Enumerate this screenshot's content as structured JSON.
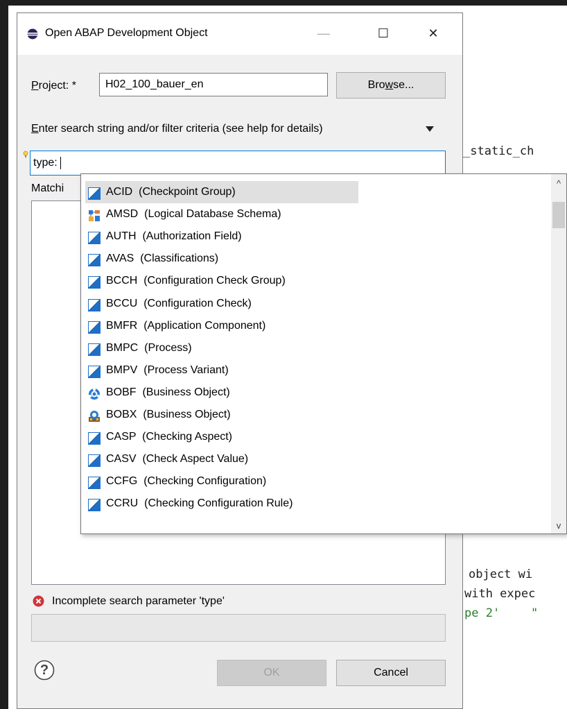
{
  "dialog": {
    "title": "Open ABAP Development Object",
    "minimize": "—",
    "maximize": "☐",
    "close": "✕",
    "project_label_mnemonic": "P",
    "project_label_rest": "roject: *",
    "project_value": "H02_100_bauer_en",
    "browse_pre": "Bro",
    "browse_mnemonic": "w",
    "browse_post": "se...",
    "search_label_mnemonic": "E",
    "search_label_rest": "nter search string and/or filter criteria (see help for details)",
    "search_value": "type: ",
    "matching_label": "Matchi",
    "error_text": "Incomplete search parameter 'type'",
    "help": "?",
    "ok": "OK",
    "cancel": "Cancel"
  },
  "editor": {
    "line1": "_static_ch",
    "line2": "object wi",
    "line3": "with expec",
    "line4": "pe 2'",
    "line4b": "\""
  },
  "popup": {
    "items": [
      {
        "code": "ACID",
        "desc": "(Checkpoint Group)",
        "icon": "abap-object-icon",
        "selected": true
      },
      {
        "code": "AMSD",
        "desc": "(Logical Database Schema)",
        "icon": "schema-icon"
      },
      {
        "code": "AUTH",
        "desc": "(Authorization Field)",
        "icon": "abap-object-icon"
      },
      {
        "code": "AVAS",
        "desc": "(Classifications)",
        "icon": "abap-object-icon"
      },
      {
        "code": "BCCH",
        "desc": "(Configuration Check Group)",
        "icon": "abap-object-icon"
      },
      {
        "code": "BCCU",
        "desc": "(Configuration Check)",
        "icon": "abap-object-icon"
      },
      {
        "code": "BMFR",
        "desc": "(Application Component)",
        "icon": "abap-object-icon"
      },
      {
        "code": "BMPC",
        "desc": "(Process)",
        "icon": "abap-object-icon"
      },
      {
        "code": "BMPV",
        "desc": "(Process Variant)",
        "icon": "abap-object-icon"
      },
      {
        "code": "BOBF",
        "desc": "(Business Object)",
        "icon": "bobf-icon"
      },
      {
        "code": "BOBX",
        "desc": "(Business Object)",
        "icon": "bobx-icon"
      },
      {
        "code": "CASP",
        "desc": "(Checking Aspect)",
        "icon": "abap-object-icon"
      },
      {
        "code": "CASV",
        "desc": "(Check Aspect Value)",
        "icon": "abap-object-icon"
      },
      {
        "code": "CCFG",
        "desc": "(Checking Configuration)",
        "icon": "abap-object-icon"
      },
      {
        "code": "CCRU",
        "desc": "(Checking Configuration Rule)",
        "icon": "abap-object-icon"
      }
    ],
    "scroll_up": "^",
    "scroll_down": "v"
  }
}
